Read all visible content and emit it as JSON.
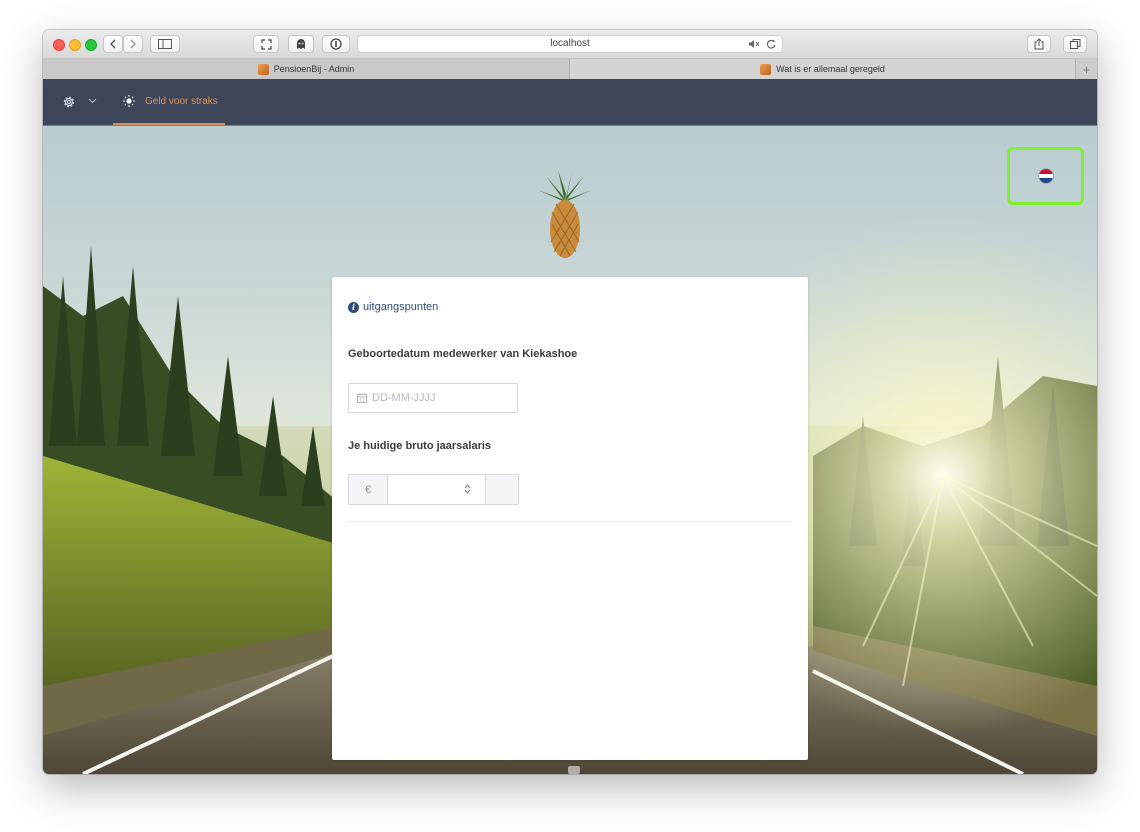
{
  "browser": {
    "url": "localhost",
    "tabs": [
      {
        "label": "PensioenBij - Admin"
      },
      {
        "label": "Wat is er allemaal geregeld"
      }
    ],
    "new_tab_symbol": "+"
  },
  "app_header": {
    "nav_label": "Geld voor straks",
    "settings_icon": "gear-icon",
    "menu_icon": "chevron-down-icon",
    "nav_icon": "sun-icon",
    "accent_color": "#e59150",
    "background_color": "#3c4658"
  },
  "language": {
    "flag": "nl-flag-icon",
    "highlight_color": "#7cf12c"
  },
  "form": {
    "info_link": "uitgangspunten",
    "birthdate_label": "Geboortedatum medewerker van Kiekashoe",
    "birthdate_placeholder": "DD-MM-JJJJ",
    "birthdate_value": "",
    "salary_label": "Je huidige bruto jaarsalaris",
    "currency_symbol": "€",
    "salary_value": ""
  }
}
